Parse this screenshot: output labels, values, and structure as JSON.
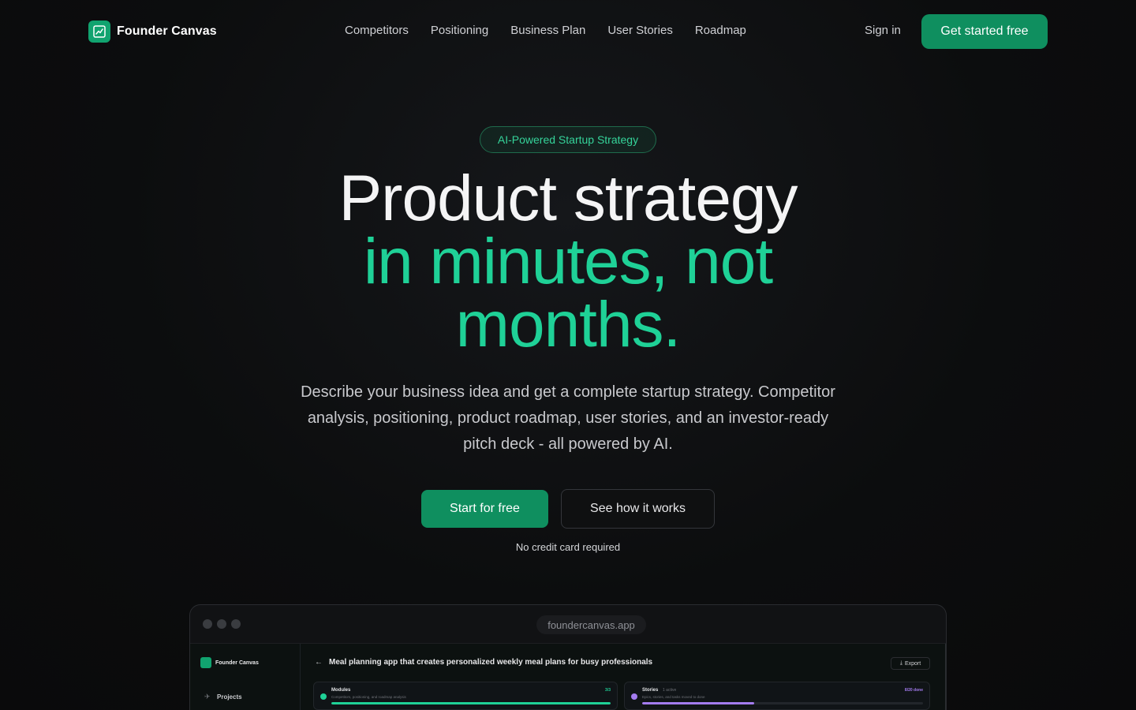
{
  "nav": {
    "brand": "Founder Canvas",
    "links": [
      "Competitors",
      "Positioning",
      "Business Plan",
      "User Stories",
      "Roadmap"
    ],
    "sign_in": "Sign in",
    "cta": "Get started free"
  },
  "hero": {
    "badge": "AI-Powered Startup Strategy",
    "headline_line1": "Product strategy",
    "headline_line2": "in minutes, not months.",
    "subtitle": "Describe your business idea and get a complete startup strategy. Competitor analysis, positioning, product roadmap, user stories, and an investor-ready pitch deck - all powered by AI.",
    "primary_button": "Start for free",
    "secondary_button": "See how it works",
    "note": "No credit card required"
  },
  "preview": {
    "url": "foundercanvas.app",
    "sidebar": {
      "brand": "Founder Canvas",
      "projects": "Projects"
    },
    "title": "Meal planning app that creates personalized weekly meal plans for busy professionals",
    "export": "Export",
    "cards": [
      {
        "title": "Modules",
        "meta": "",
        "subtitle": "Competitors, positioning, and roadmap analysis",
        "count": "3/3",
        "progress": 1.0,
        "color": "#1fd197"
      },
      {
        "title": "Stories",
        "meta": "1 active",
        "subtitle": "Epics, stories, and tasks moved to done",
        "count": "8/20 done",
        "progress": 0.4,
        "color": "#a47cf0"
      }
    ]
  },
  "colors": {
    "accent": "#1fd197",
    "button": "#0f8f5f",
    "background": "#0b0b0c"
  }
}
